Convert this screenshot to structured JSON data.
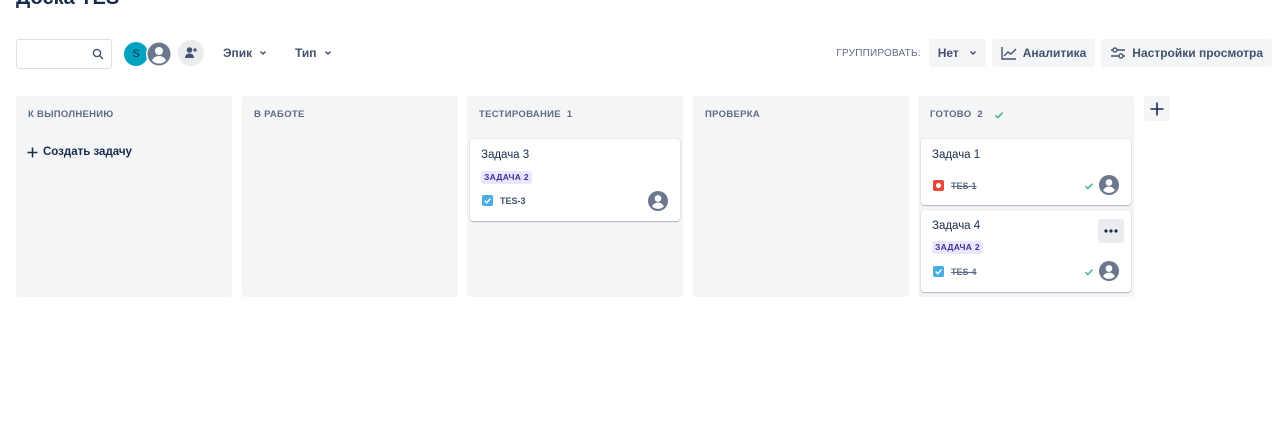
{
  "board": {
    "title": "Доска TES"
  },
  "toolbar": {
    "search": {
      "value": "",
      "placeholder": ""
    },
    "avatar_initial": "S",
    "filters": [
      {
        "label": "Эпик"
      },
      {
        "label": "Тип"
      }
    ],
    "group_label": "ГРУППИРОВАТЬ:",
    "group_value": "Нет",
    "analytics_label": "Аналитика",
    "view_settings_label": "Настройки просмотра"
  },
  "columns": [
    {
      "title": "К ВЫПОЛНЕНИЮ",
      "count": "",
      "create_label": "Создать задачу"
    },
    {
      "title": "В РАБОТЕ",
      "count": ""
    },
    {
      "title": "ТЕСТИРОВАНИЕ",
      "count": "1"
    },
    {
      "title": "ПРОВЕРКА",
      "count": ""
    },
    {
      "title": "ГОТОВО",
      "count": "2"
    }
  ],
  "cards": {
    "c3": {
      "title": "Задача 3",
      "epic": "ЗАДАЧА 2",
      "key": "TES-3",
      "type": "task"
    },
    "c1": {
      "title": "Задача 1",
      "key": "TES-1",
      "type": "bug",
      "done": true
    },
    "c4": {
      "title": "Задача 4",
      "epic": "ЗАДАЧА 2",
      "key": "TES-4",
      "type": "task",
      "done": true
    }
  },
  "colors": {
    "accent": "#0052cc",
    "epic_bg": "#eae6ff",
    "epic_text": "#403294",
    "bug": "#e5493a",
    "task": "#4bade8",
    "done_check": "#36b37e",
    "avatar_s": "#00a3bf"
  }
}
